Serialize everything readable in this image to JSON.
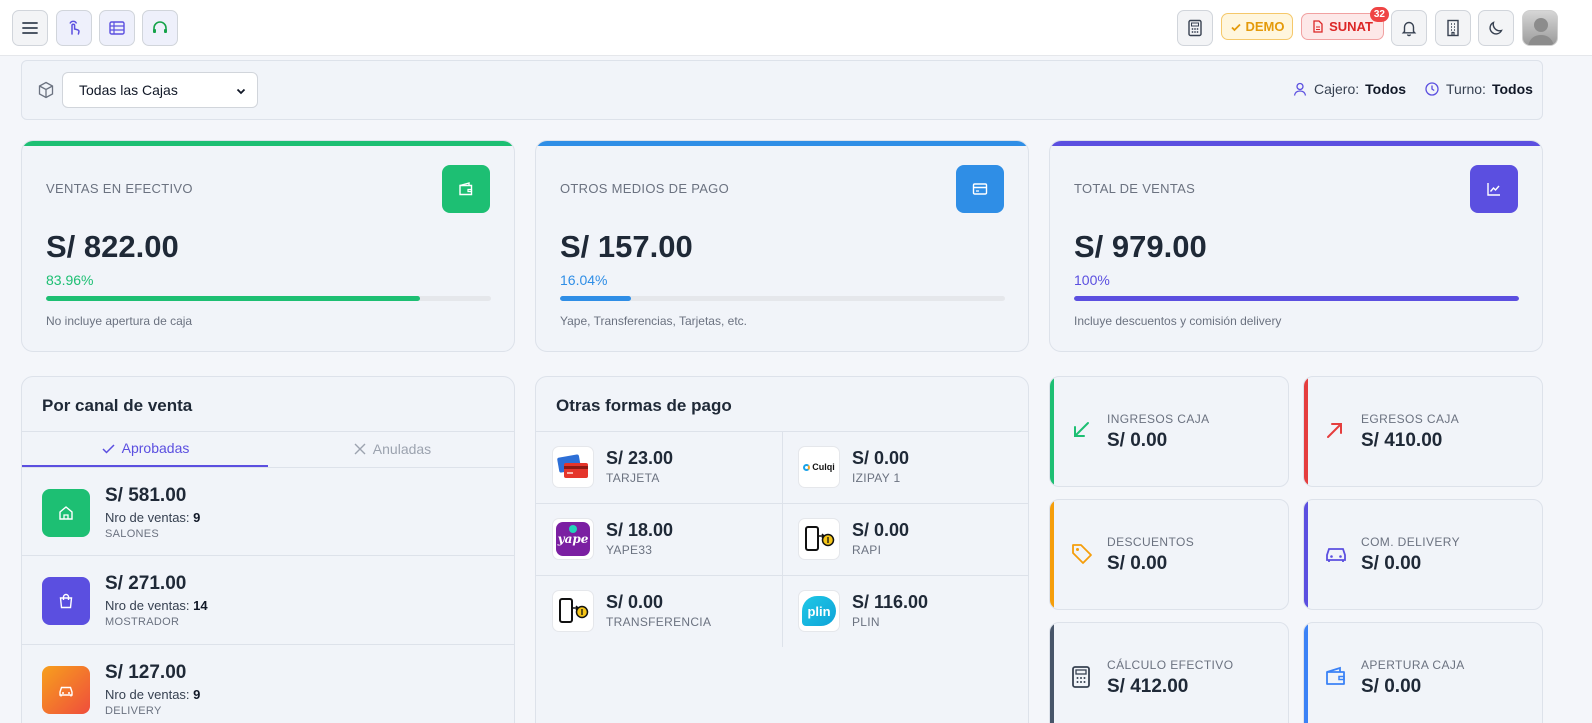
{
  "header": {
    "demo_label": "DEMO",
    "sunat_label": "SUNAT",
    "sunat_count": "32"
  },
  "filters": {
    "caja_selected": "Todas las Cajas",
    "cajero_label": "Cajero:",
    "cajero_value": "Todos",
    "turno_label": "Turno:",
    "turno_value": "Todos"
  },
  "stats": [
    {
      "label": "VENTAS EN EFECTIVO",
      "amount": "S/ 822.00",
      "percent": "83.96%",
      "fill": 83.96,
      "note": "No incluye apertura de caja",
      "color": "#1dbf73"
    },
    {
      "label": "OTROS MEDIOS DE PAGO",
      "amount": "S/ 157.00",
      "percent": "16.04%",
      "fill": 16.04,
      "note": "Yape, Transferencias, Tarjetas, etc.",
      "color": "#2f8ee6"
    },
    {
      "label": "TOTAL DE VENTAS",
      "amount": "S/ 979.00",
      "percent": "100%",
      "fill": 100,
      "note": "Incluye descuentos y comisión delivery",
      "color": "#5b4fe0"
    }
  ],
  "canal": {
    "title": "Por canal de venta",
    "tab_aprobadas": "Aprobadas",
    "tab_anuladas": "Anuladas",
    "count_label": "Nro de ventas:",
    "rows": [
      {
        "amount": "S/ 581.00",
        "count": "9",
        "name": "SALONES"
      },
      {
        "amount": "S/ 271.00",
        "count": "14",
        "name": "MOSTRADOR"
      },
      {
        "amount": "S/ 127.00",
        "count": "9",
        "name": "DELIVERY"
      }
    ]
  },
  "otras": {
    "title": "Otras formas de pago",
    "items": [
      {
        "amount": "S/ 23.00",
        "name": "TARJETA"
      },
      {
        "amount": "S/ 0.00",
        "name": "IZIPAY 1",
        "logo_text": "Culqi"
      },
      {
        "amount": "S/ 18.00",
        "name": "YAPE33",
        "logo_text": "yape"
      },
      {
        "amount": "S/ 0.00",
        "name": "RAPI"
      },
      {
        "amount": "S/ 0.00",
        "name": "TRANSFERENCIA"
      },
      {
        "amount": "S/ 116.00",
        "name": "PLIN",
        "logo_text": "plin"
      }
    ]
  },
  "mini": [
    {
      "label": "INGRESOS CAJA",
      "value": "S/ 0.00",
      "color": "#1dbf73",
      "icon": "arrow-down-left-icon"
    },
    {
      "label": "EGRESOS CAJA",
      "value": "S/ 410.00",
      "color": "#e53e3e",
      "icon": "arrow-up-right-icon"
    },
    {
      "label": "DESCUENTOS",
      "value": "S/ 0.00",
      "color": "#f59e0b",
      "icon": "tag-icon"
    },
    {
      "label": "COM. DELIVERY",
      "value": "S/ 0.00",
      "color": "#5b4fe0",
      "icon": "car-icon"
    },
    {
      "label": "CÁLCULO EFECTIVO",
      "value": "S/ 412.00",
      "color": "#475569",
      "icon": "calculator-icon"
    },
    {
      "label": "APERTURA CAJA",
      "value": "S/ 0.00",
      "color": "#3b82f6",
      "icon": "wallet-icon"
    }
  ]
}
